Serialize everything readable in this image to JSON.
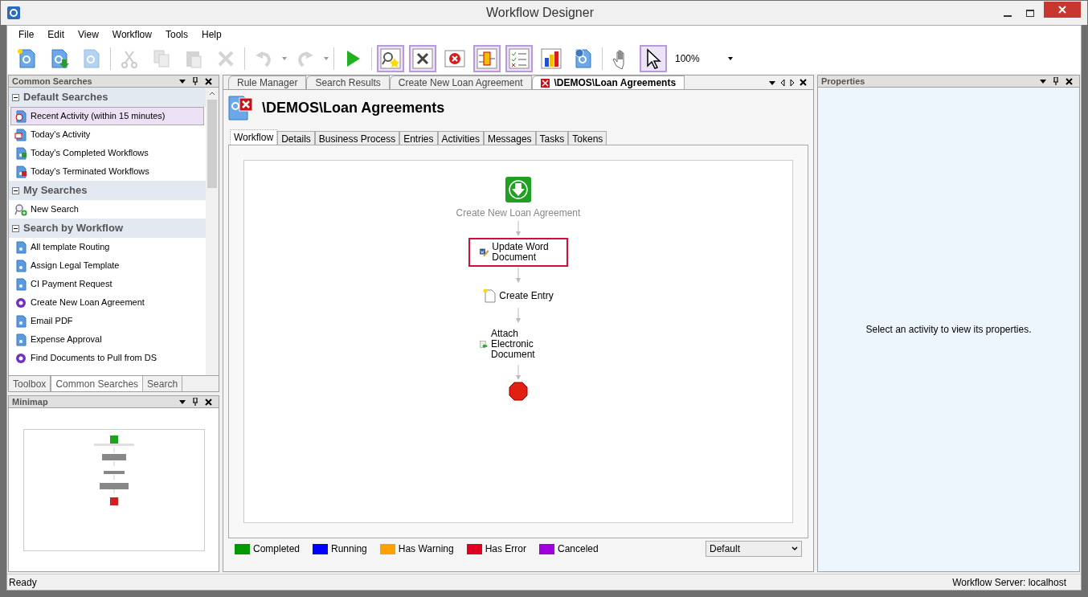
{
  "window": {
    "title": "Workflow Designer"
  },
  "menu": [
    "File",
    "Edit",
    "View",
    "Workflow",
    "Tools",
    "Help"
  ],
  "toolbar": [
    {
      "kind": "new",
      "selected": false,
      "disabled": false
    },
    {
      "kind": "import",
      "selected": false,
      "disabled": false
    },
    {
      "kind": "export",
      "selected": false,
      "disabled": true
    },
    {
      "kind": "cut",
      "selected": false,
      "disabled": true
    },
    {
      "kind": "copy",
      "selected": false,
      "disabled": true
    },
    {
      "kind": "paste",
      "selected": false,
      "disabled": true
    },
    {
      "kind": "delete",
      "selected": false,
      "disabled": true
    },
    {
      "kind": "undo",
      "selected": false,
      "disabled": true
    },
    {
      "kind": "redo",
      "selected": false,
      "disabled": true
    },
    {
      "kind": "run",
      "selected": false,
      "disabled": false
    },
    {
      "kind": "find",
      "selected": true,
      "disabled": false
    },
    {
      "kind": "tools",
      "selected": true,
      "disabled": false
    },
    {
      "kind": "stop",
      "selected": false,
      "disabled": false
    },
    {
      "kind": "layout",
      "selected": true,
      "disabled": false
    },
    {
      "kind": "checklist",
      "selected": true,
      "disabled": false
    },
    {
      "kind": "chart",
      "selected": false,
      "disabled": false
    },
    {
      "kind": "info",
      "selected": false,
      "disabled": false
    },
    {
      "kind": "hand",
      "selected": false,
      "disabled": false
    },
    {
      "kind": "pointer",
      "selected": true,
      "disabled": false
    }
  ],
  "zoom": "100%",
  "common_searches": {
    "title": "Common Searches",
    "groups": [
      {
        "title": "Default Searches",
        "expanded": true,
        "items": [
          {
            "label": "Recent Activity (within 15 minutes)",
            "kind": "clock",
            "selected": true
          },
          {
            "label": "Today's Activity",
            "kind": "calendar",
            "selected": false
          },
          {
            "label": "Today's Completed Workflows",
            "kind": "done",
            "selected": false
          },
          {
            "label": "Today's Terminated Workflows",
            "kind": "terminated",
            "selected": false
          }
        ]
      },
      {
        "title": "My Searches",
        "expanded": true,
        "items": [
          {
            "label": "New Search",
            "kind": "search",
            "selected": false
          }
        ]
      },
      {
        "title": "Search by Workflow",
        "expanded": true,
        "items": [
          {
            "label": "All template Routing",
            "kind": "workflow",
            "selected": false
          },
          {
            "label": "Assign Legal Template",
            "kind": "workflow",
            "selected": false
          },
          {
            "label": "CI Payment Request",
            "kind": "workflow",
            "selected": false
          },
          {
            "label": "Create New Loan Agreement",
            "kind": "gear",
            "selected": false
          },
          {
            "label": "Email PDF",
            "kind": "workflow",
            "selected": false
          },
          {
            "label": "Expense Approval",
            "kind": "workflow",
            "selected": false
          },
          {
            "label": "Find Documents to Pull from DS",
            "kind": "gear",
            "selected": false
          }
        ]
      }
    ],
    "tabs": [
      {
        "label": "Toolbox",
        "selected": false
      },
      {
        "label": "Common Searches",
        "selected": true
      },
      {
        "label": "Search",
        "selected": false
      }
    ]
  },
  "minimap": {
    "title": "Minimap"
  },
  "documents": {
    "tabs": [
      {
        "label": "Rule Manager",
        "selected": false,
        "error": false
      },
      {
        "label": "Search Results",
        "selected": false,
        "error": false
      },
      {
        "label": "Create New Loan Agreement",
        "selected": false,
        "error": false
      },
      {
        "label": "\\DEMOS\\Loan Agreements",
        "selected": true,
        "error": true
      }
    ],
    "heading": "\\DEMOS\\Loan Agreements",
    "tabs2": [
      {
        "label": "Workflow",
        "selected": true
      },
      {
        "label": "Details",
        "selected": false
      },
      {
        "label": "Business Process",
        "selected": false
      },
      {
        "label": "Entries",
        "selected": false
      },
      {
        "label": "Activities",
        "selected": false
      },
      {
        "label": "Messages",
        "selected": false
      },
      {
        "label": "Tasks",
        "selected": false
      },
      {
        "label": "Tokens",
        "selected": false
      }
    ],
    "nodes": [
      {
        "kind": "start",
        "label": "Create New Loan Agreement",
        "selected": false
      },
      {
        "kind": "word",
        "label": "Update Word Document",
        "selected": true
      },
      {
        "kind": "entry",
        "label": "Create Entry",
        "selected": false
      },
      {
        "kind": "attach",
        "label": "Attach Electronic Document",
        "selected": false
      },
      {
        "kind": "end",
        "selected": false
      }
    ],
    "legend": [
      {
        "label": "Completed",
        "color": "#009900"
      },
      {
        "label": "Running",
        "color": "#0000ff"
      },
      {
        "label": "Has Warning",
        "color": "#ffa000"
      },
      {
        "label": "Has Error",
        "color": "#e00020"
      },
      {
        "label": "Canceled",
        "color": "#a000e0"
      }
    ],
    "view_select": "Default"
  },
  "properties": {
    "title": "Properties",
    "message": "Select an activity to view its properties."
  },
  "status_bar": {
    "left": "Ready",
    "right": "Workflow Server: localhost"
  }
}
